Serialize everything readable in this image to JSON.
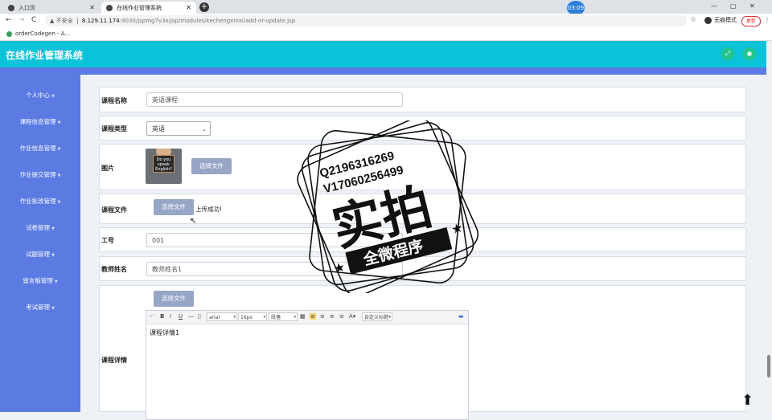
{
  "browser": {
    "tabs": [
      {
        "label": "入口页"
      },
      {
        "label": "在线作业管理系统"
      }
    ],
    "new_tab": "+",
    "timer": "03:09",
    "win_controls": {
      "min": "—",
      "max": "▢",
      "close": "✕"
    },
    "nav": {
      "back": "←",
      "forward": "→",
      "reload": "C"
    },
    "url": {
      "security": "不安全",
      "host": "8.129.11.174",
      "path": ":9030/jspmg7v3x/jsp/modules/kechengxinxi/add-or-update.jsp"
    },
    "profile": "无痕模式",
    "update_label": "更新",
    "bookmark": "orderCodegen - A..."
  },
  "header": {
    "title": "在线作业管理系统",
    "fullscreen_icon": "expand-icon",
    "user_icon": "user-icon"
  },
  "sidebar": {
    "items": [
      {
        "label": "个人中心"
      },
      {
        "label": "课程信息管理"
      },
      {
        "label": "作业信息管理"
      },
      {
        "label": "作业提交管理"
      },
      {
        "label": "作业批改管理"
      },
      {
        "label": "试卷管理"
      },
      {
        "label": "试题管理"
      },
      {
        "label": "留言板管理"
      },
      {
        "label": "考试管理"
      }
    ]
  },
  "form": {
    "course_name": {
      "label": "课程名称",
      "value": "英语课程"
    },
    "course_type": {
      "label": "课程类型",
      "value": "英语"
    },
    "image": {
      "label": "图片",
      "button": "选择文件",
      "thumb_text": "Do you speak English?"
    },
    "course_file": {
      "label": "课程文件",
      "button": "选择文件",
      "status": "上传成功!"
    },
    "job_no": {
      "label": "工号",
      "value": "001"
    },
    "teacher_name": {
      "label": "教师姓名",
      "value": "教师姓名1"
    },
    "course_detail": {
      "label": "课程详情",
      "button": "选择文件",
      "toolbar": {
        "font": "arial",
        "size": "16px",
        "paragraph": "段落",
        "custom_title": "自定义标题"
      },
      "content": "课程详情1"
    }
  },
  "watermark": {
    "line1": "Q2196316269",
    "line2": "V17060256499",
    "big": "实拍",
    "banner": "全微程序"
  }
}
